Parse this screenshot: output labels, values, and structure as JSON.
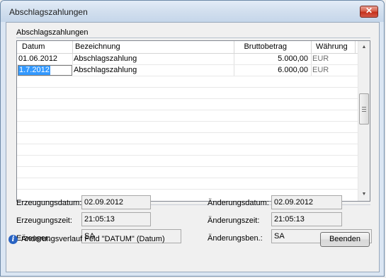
{
  "window": {
    "title": "Abschlagszahlungen"
  },
  "group": {
    "label": "Abschlagszahlungen"
  },
  "grid": {
    "headers": [
      "Datum",
      "Bezeichnung",
      "Bruttobetrag",
      "Währung"
    ],
    "rows": [
      {
        "datum": "01.06.2012",
        "bezeichnung": "Abschlagszahlung",
        "betrag": "5.000,00",
        "waehrung": "EUR"
      },
      {
        "datum": "1.7.2012",
        "bezeichnung": "Abschlagszahlung",
        "betrag": "6.000,00",
        "waehrung": "EUR"
      }
    ]
  },
  "fields": {
    "erzeugungsdatum": {
      "label": "Erzeugungsdatum:",
      "value": "02.09.2012"
    },
    "erzeugungszeit": {
      "label": "Erzeugungszeit:",
      "value": "21:05:13"
    },
    "erzeuger": {
      "label": "Erzeuger:",
      "value": "SA"
    },
    "aenderungsdatum": {
      "label": "Änderungsdatum:",
      "value": "02.09.2012"
    },
    "aenderungszeit": {
      "label": "Änderungszeit:",
      "value": "21:05:13"
    },
    "aenderungsben": {
      "label": "Änderungsben.:",
      "value": "SA"
    }
  },
  "status": {
    "icon": "info-icon",
    "text": "Änderungsverlauf Feld \"DATUM\" (Datum)"
  },
  "buttons": {
    "beenden": "Beenden",
    "close_glyph": "✕"
  },
  "colors": {
    "selection": "#3399ff",
    "close": "#c5311b"
  }
}
